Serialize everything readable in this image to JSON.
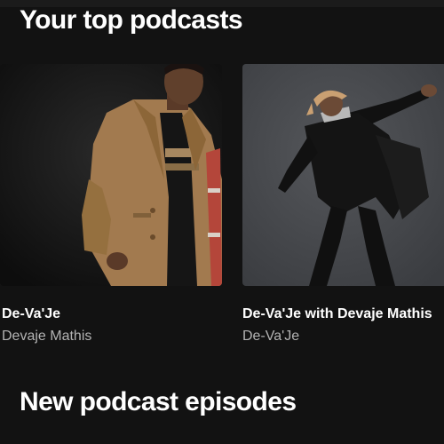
{
  "sections": [
    {
      "title": "Your top podcasts",
      "cards": [
        {
          "title": "De-Va'Je",
          "subtitle": "Devaje Mathis",
          "artwork": "portrait-camel-coat-artwork"
        },
        {
          "title": "De-Va'Je with Devaje Mathis",
          "subtitle": "De-Va'Je",
          "artwork": "dancing-figure-artwork"
        }
      ]
    },
    {
      "title": "New podcast episodes"
    }
  ],
  "colors": {
    "background": "#121212",
    "title_text": "#ffffff",
    "subtitle_text": "#b3b3b3"
  }
}
